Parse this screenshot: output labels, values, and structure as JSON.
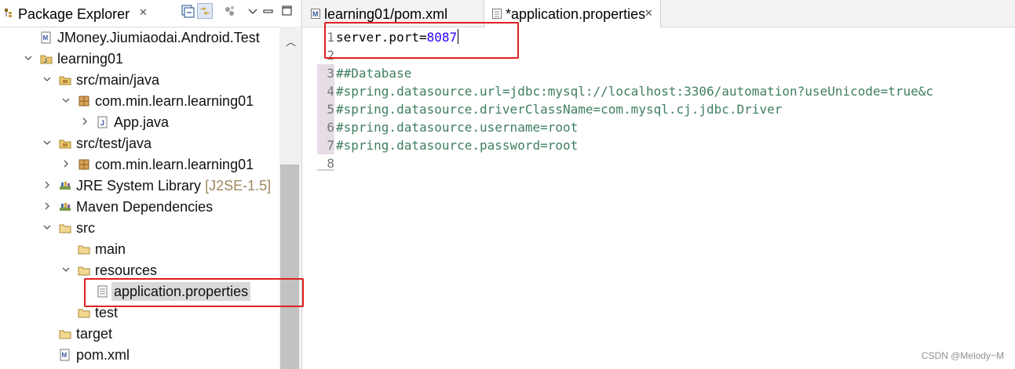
{
  "explorer": {
    "title": "Package Explorer",
    "close": "✕"
  },
  "tree": [
    {
      "label": "JMoney.Jiumiaodai.Android.Test",
      "depth": 1,
      "twisty": "none",
      "icon": "project-icon"
    },
    {
      "label": "learning01",
      "depth": 1,
      "twisty": "open",
      "icon": "maven-project-icon"
    },
    {
      "label": "src/main/java",
      "depth": 2,
      "twisty": "open",
      "icon": "source-folder-icon"
    },
    {
      "label": "com.min.learn.learning01",
      "depth": 3,
      "twisty": "open",
      "icon": "package-icon"
    },
    {
      "label": "App.java",
      "depth": 4,
      "twisty": "closed",
      "icon": "java-file-icon"
    },
    {
      "label": "src/test/java",
      "depth": 2,
      "twisty": "open",
      "icon": "source-folder-icon"
    },
    {
      "label": "com.min.learn.learning01",
      "depth": 3,
      "twisty": "closed",
      "icon": "package-icon"
    },
    {
      "label": "JRE System Library",
      "suffix": "[J2SE-1.5]",
      "depth": 2,
      "twisty": "closed",
      "icon": "library-icon"
    },
    {
      "label": "Maven Dependencies",
      "depth": 2,
      "twisty": "closed",
      "icon": "library-icon"
    },
    {
      "label": "src",
      "depth": 2,
      "twisty": "open",
      "icon": "folder-icon"
    },
    {
      "label": "main",
      "depth": 3,
      "twisty": "none",
      "icon": "folder-icon"
    },
    {
      "label": "resources",
      "depth": 3,
      "twisty": "open",
      "icon": "folder-icon"
    },
    {
      "label": "application.properties",
      "depth": 4,
      "twisty": "none",
      "icon": "properties-file-icon",
      "selected": true
    },
    {
      "label": "test",
      "depth": 3,
      "twisty": "none",
      "icon": "folder-icon"
    },
    {
      "label": "target",
      "depth": 2,
      "twisty": "none",
      "icon": "folder-icon"
    },
    {
      "label": "pom.xml",
      "depth": 2,
      "twisty": "none",
      "icon": "xml-file-icon"
    }
  ],
  "editor": {
    "tabs": [
      {
        "label": "learning01/pom.xml",
        "active": false
      },
      {
        "label": "*application.properties",
        "active": true,
        "close": "✕"
      }
    ],
    "line_numbers": [
      "1",
      "2",
      "3",
      "4",
      "5",
      "6",
      "7",
      "8"
    ],
    "lines": [
      {
        "key": "server.port=",
        "value": "8087"
      },
      {
        "text": ""
      },
      {
        "text": "##Database"
      },
      {
        "text": "#spring.datasource.url=jdbc:mysql://localhost:3306/automation?useUnicode=true&c"
      },
      {
        "text": "#spring.datasource.driverClassName=com.mysql.cj.jdbc.Driver"
      },
      {
        "text": "#spring.datasource.username=root"
      },
      {
        "text": "#spring.datasource.password=root"
      },
      {
        "text": ""
      }
    ]
  },
  "watermark": "CSDN @Melody~M",
  "colors": {
    "highlight": "#e02020",
    "comment": "#3f7f5f",
    "value": "#2a00ff",
    "selection": "#d9d9d9"
  }
}
